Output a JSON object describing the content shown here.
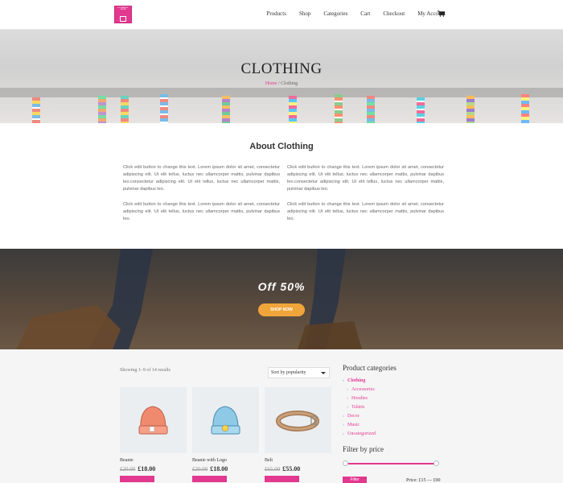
{
  "header": {
    "logo_text": "ECOMMERCE ONLINE",
    "nav": [
      "Products",
      "Shop",
      "Categories",
      "Cart",
      "Checkout",
      "My Account"
    ],
    "cart_icon": "cart-icon"
  },
  "hero": {
    "title": "CLOTHING",
    "breadcrumb_home": "Home",
    "breadcrumb_sep": " / ",
    "breadcrumb_current": "Clothing"
  },
  "about": {
    "title": "About Clothing",
    "p1": "Click edit button to change this text. Lorem ipsum dolor sit amet, consectetur adipiscing elit. Ut elit tellus, luctus nec ullamcorper mattis, pulvinar dapibus leo.consectetur adipiscing elit. Ut elit tellus, luctus nec ullamcorper mattis, pulvinar dapibus leo.",
    "p2": "Click edit button to change this text. Lorem ipsum dolor sit amet, consectetur adipiscing elit. Ut elit tellus, luctus nec ullamcorper mattis, pulvinar dapibus leo.",
    "p3": "Click edit button to change this text. Lorem ipsum dolor sit amet, consectetur adipiscing elit. Ut elit tellus, luctus nec ullamcorper mattis, pulvinar dapibus leo.consectetur adipiscing elit. Ut elit tellus, luctus nec ullamcorper mattis, pulvinar dapibus leo.",
    "p4": "Click edit button to change this text. Lorem ipsum dolor sit amet, consectetur adipiscing elit. Ut elit tellus, luctus nec ullamcorper mattis, pulvinar dapibus leo."
  },
  "promo": {
    "title": "Off 50%",
    "button": "SHOP NOW"
  },
  "shop": {
    "results": "Showing 1–9 of 14 results",
    "sort_value": "Sort by popularity",
    "products": [
      {
        "name": "Beanie",
        "old_price": "£20.00",
        "new_price": "£18.00"
      },
      {
        "name": "Beanie with Logo",
        "old_price": "£20.00",
        "new_price": "£18.00"
      },
      {
        "name": "Belt",
        "old_price": "£65.00",
        "new_price": "£55.00"
      }
    ]
  },
  "sidebar": {
    "categories_title": "Product categories",
    "categories": [
      {
        "label": "Clothing",
        "level": 0,
        "bold": true
      },
      {
        "label": "Accessories",
        "level": 1
      },
      {
        "label": "Hoodies",
        "level": 1
      },
      {
        "label": "Tshirts",
        "level": 1
      },
      {
        "label": "Decor",
        "level": 0
      },
      {
        "label": "Music",
        "level": 0
      },
      {
        "label": "Uncategorized",
        "level": 0
      }
    ],
    "filter_title": "Filter by price",
    "filter_button": "Filter",
    "price_range": "Price: £15 — £90"
  },
  "colors": {
    "accent": "#e2388f",
    "promo_button": "#f0a53a"
  }
}
